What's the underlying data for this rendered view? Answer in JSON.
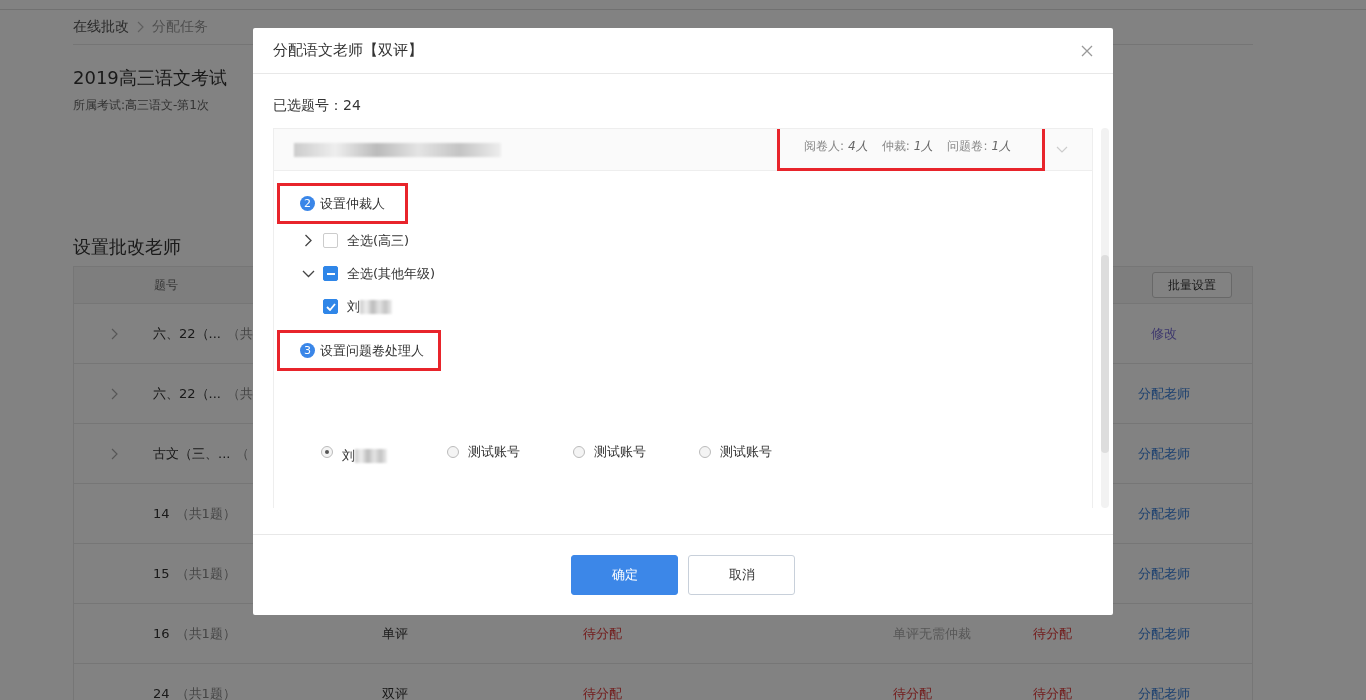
{
  "breadcrumb": [
    {
      "label": "在线批改"
    },
    {
      "label": "分配任务"
    }
  ],
  "exam": {
    "title": "2019高三语文考试",
    "subtitle": "所属考试:高三语文-第1次"
  },
  "section_title": "设置批改老师",
  "table": {
    "columns": [
      "题号"
    ],
    "batch_button": "批量设置",
    "rows": [
      {
        "expandable": true,
        "question": "六、22（...",
        "count": "（共",
        "cells": [],
        "action": {
          "label": "修改",
          "kind": "edit"
        }
      },
      {
        "expandable": true,
        "question": "六、22（...",
        "count": "（共",
        "cells": [],
        "action": {
          "label": "分配老师",
          "kind": "assign"
        }
      },
      {
        "expandable": true,
        "question": "古文（三、...",
        "count": "（",
        "cells": [],
        "action": {
          "label": "分配老师",
          "kind": "assign"
        }
      },
      {
        "expandable": false,
        "question": "14",
        "count": "（共1题）",
        "cells": [],
        "action": {
          "label": "分配老师",
          "kind": "assign"
        }
      },
      {
        "expandable": false,
        "question": "15",
        "count": "（共1题）",
        "cells": [],
        "action": {
          "label": "分配老师",
          "kind": "assign"
        }
      },
      {
        "expandable": false,
        "question": "16",
        "count": "（共1题）",
        "cells": [
          {
            "text": "单评",
            "kind": "plain"
          },
          {
            "text": "待分配",
            "kind": "pending"
          },
          {
            "text": "单评无需仲裁",
            "kind": "muted"
          },
          {
            "text": "待分配",
            "kind": "pending"
          }
        ],
        "action": {
          "label": "分配老师",
          "kind": "assign"
        }
      },
      {
        "expandable": false,
        "question": "24",
        "count": "（共1题）",
        "cells": [
          {
            "text": "双评",
            "kind": "plain"
          },
          {
            "text": "待分配",
            "kind": "pending"
          },
          {
            "text": "待分配",
            "kind": "pending"
          },
          {
            "text": "待分配",
            "kind": "pending"
          }
        ],
        "action": {
          "label": "分配老师",
          "kind": "assign"
        }
      }
    ]
  },
  "dialog": {
    "title": "分配语文老师【双评】",
    "selected_label": "已选题号：24",
    "stats_highlighted": true,
    "stats": [
      {
        "label": "阅卷人:",
        "value": "4人"
      },
      {
        "label": "仲裁:",
        "value": "1人"
      },
      {
        "label": "问题卷:",
        "value": "1人"
      }
    ],
    "arbiter": {
      "step": "2",
      "title": "设置仲裁人",
      "highlighted": true,
      "tree": [
        {
          "label": "全选(高三)",
          "expanded": false,
          "checked": false,
          "indeterminate": false
        },
        {
          "label": "全选(其他年级)",
          "expanded": true,
          "checked": true,
          "indeterminate": true,
          "children": [
            {
              "label": "刘",
              "checked": true
            }
          ]
        }
      ]
    },
    "problem": {
      "step": "3",
      "title": "设置问题卷处理人",
      "highlighted": true,
      "options": [
        {
          "label": "刘",
          "redacted": true,
          "selected": true
        },
        {
          "label": "测试账号",
          "redacted": false,
          "selected": false
        },
        {
          "label": "测试账号",
          "redacted": false,
          "selected": false
        },
        {
          "label": "测试账号",
          "redacted": false,
          "selected": false
        }
      ]
    },
    "buttons": [
      {
        "label": "确定",
        "kind": "primary"
      },
      {
        "label": "取消",
        "kind": "default"
      }
    ]
  }
}
